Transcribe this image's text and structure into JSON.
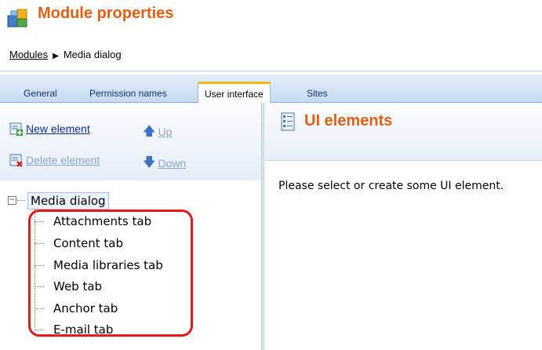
{
  "header": {
    "title": "Module properties",
    "icon": "module-blocks-icon"
  },
  "breadcrumb": {
    "link": "Modules",
    "current": "Media dialog"
  },
  "tabs": [
    {
      "label": "General",
      "active": false
    },
    {
      "label": "Permission names",
      "active": false
    },
    {
      "label": "User interface",
      "active": true
    },
    {
      "label": "Sites",
      "active": false
    }
  ],
  "toolbar": {
    "new_element": "New element",
    "up": "Up",
    "delete_element": "Delete element",
    "down": "Down"
  },
  "tree": {
    "root": "Media dialog",
    "items": [
      "Attachments tab",
      "Content tab",
      "Media libraries tab",
      "Web tab",
      "Anchor tab",
      "E-mail tab"
    ]
  },
  "right": {
    "title": "UI elements",
    "message": "Please select or create some UI element."
  },
  "colors": {
    "title_orange": "#e35f14",
    "link_blue": "#0d2c8c",
    "highlight_red": "#e11b1b",
    "active_tab_accent": "#f4b919"
  }
}
